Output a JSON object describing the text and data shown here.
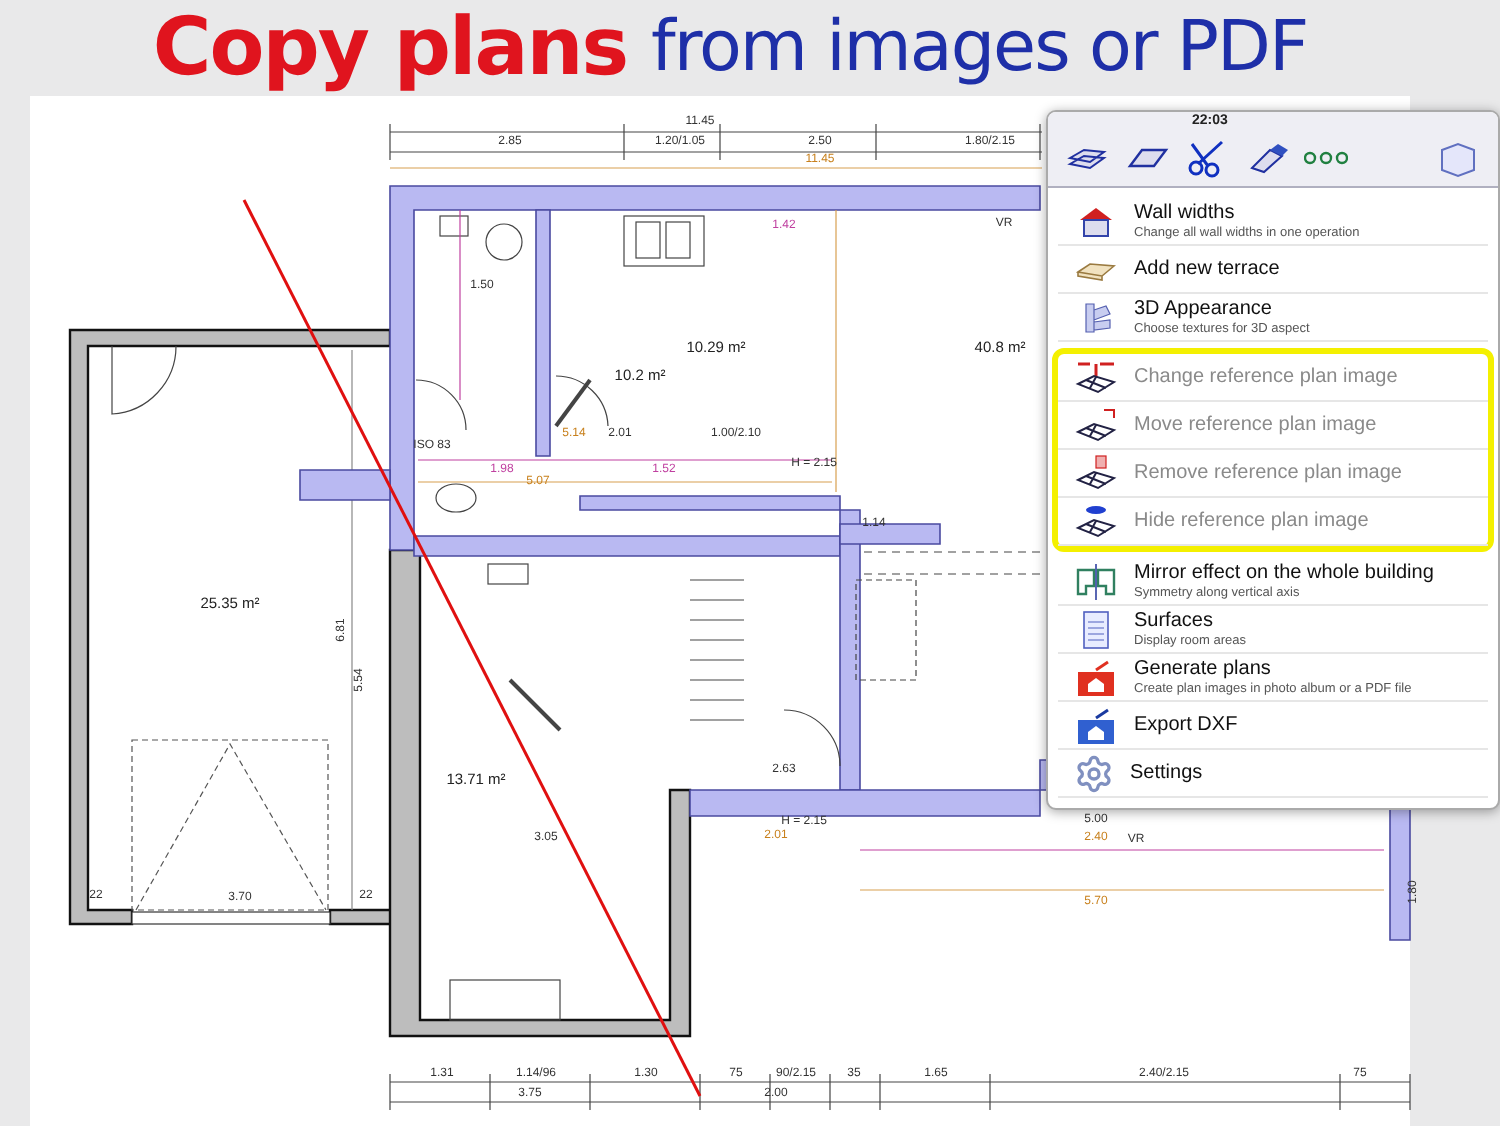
{
  "headline": {
    "lead": "Copy plans",
    "rest": "from images or PDF"
  },
  "plan": {
    "labels": [
      {
        "text": "11.45",
        "kind": "dimension"
      },
      {
        "text": "2.85",
        "kind": "dimension"
      },
      {
        "text": "1.20/1.05",
        "kind": "dimension"
      },
      {
        "text": "2.50",
        "kind": "dimension"
      },
      {
        "text": "1.80/2.15",
        "kind": "dimension"
      },
      {
        "text": "11.45",
        "kind": "measure"
      },
      {
        "text": "1.50",
        "kind": "dimension"
      },
      {
        "text": "1.42",
        "kind": "note"
      },
      {
        "text": "VR",
        "kind": "dimension"
      },
      {
        "text": "10.29 m²",
        "kind": "area"
      },
      {
        "text": "10.2 m²",
        "kind": "area"
      },
      {
        "text": "40.8 m²",
        "kind": "area"
      },
      {
        "text": "ISO 83",
        "kind": "dimension"
      },
      {
        "text": "5.14",
        "kind": "measure"
      },
      {
        "text": "2.01",
        "kind": "dimension"
      },
      {
        "text": "1.00/2.10",
        "kind": "dimension"
      },
      {
        "text": "H = 2.15",
        "kind": "dimension"
      },
      {
        "text": "1.98",
        "kind": "note"
      },
      {
        "text": "5.07",
        "kind": "measure"
      },
      {
        "text": "1.52",
        "kind": "note"
      },
      {
        "text": "1.14",
        "kind": "dimension"
      },
      {
        "text": "25.35 m²",
        "kind": "area"
      },
      {
        "text": "6.81",
        "kind": "dimension"
      },
      {
        "text": "5.54",
        "kind": "dimension"
      },
      {
        "text": "22",
        "kind": "dimension"
      },
      {
        "text": "3.70",
        "kind": "dimension"
      },
      {
        "text": "22",
        "kind": "dimension"
      },
      {
        "text": "2.63",
        "kind": "dimension"
      },
      {
        "text": "13.71 m²",
        "kind": "area"
      },
      {
        "text": "3.05",
        "kind": "dimension"
      },
      {
        "text": "H = 2.15",
        "kind": "dimension"
      },
      {
        "text": "2.01",
        "kind": "measure"
      },
      {
        "text": "5.00",
        "kind": "dimension"
      },
      {
        "text": "2.40",
        "kind": "measure"
      },
      {
        "text": "VR",
        "kind": "dimension"
      },
      {
        "text": "5.70",
        "kind": "measure"
      },
      {
        "text": "1.80",
        "kind": "dimension"
      },
      {
        "text": "1.31",
        "kind": "dimension"
      },
      {
        "text": "1.14/96",
        "kind": "dimension"
      },
      {
        "text": "1.30",
        "kind": "dimension"
      },
      {
        "text": "75",
        "kind": "dimension"
      },
      {
        "text": "90/2.15",
        "kind": "dimension"
      },
      {
        "text": "35",
        "kind": "dimension"
      },
      {
        "text": "1.65",
        "kind": "dimension"
      },
      {
        "text": "2.40/2.15",
        "kind": "dimension"
      },
      {
        "text": "75",
        "kind": "dimension"
      },
      {
        "text": "3.75",
        "kind": "dimension"
      },
      {
        "text": "2.00",
        "kind": "dimension"
      }
    ]
  },
  "menu": {
    "time": "22:03",
    "sections": [
      {
        "highlighted": false,
        "items": [
          {
            "label": "Wall widths",
            "subtitle": "Change all wall widths in one operation",
            "disabled": false
          },
          {
            "label": "Add new terrace",
            "disabled": false
          },
          {
            "label": "3D Appearance",
            "subtitle": "Choose textures for 3D aspect",
            "disabled": false
          }
        ]
      },
      {
        "highlighted": true,
        "items": [
          {
            "label": "Change reference plan image",
            "disabled": true
          },
          {
            "label": "Move reference plan image",
            "disabled": true
          },
          {
            "label": "Remove reference plan image",
            "disabled": true
          },
          {
            "label": "Hide reference plan image",
            "disabled": true
          }
        ]
      },
      {
        "highlighted": false,
        "items": [
          {
            "label": "Mirror effect on the whole building",
            "subtitle": "Symmetry along vertical axis",
            "disabled": false
          },
          {
            "label": "Surfaces",
            "subtitle": "Display room areas",
            "disabled": false
          },
          {
            "label": "Generate plans",
            "subtitle": "Create plan images in photo album or a PDF file",
            "disabled": false
          },
          {
            "label": "Export DXF",
            "disabled": false
          },
          {
            "label": "Settings",
            "disabled": false
          }
        ]
      }
    ]
  }
}
